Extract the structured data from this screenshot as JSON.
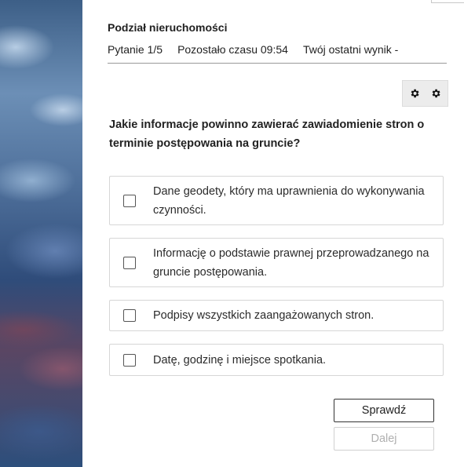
{
  "quiz": {
    "title": "Podział nieruchomości",
    "question_counter": "Pytanie 1/5",
    "time_left": "Pozostało czasu 09:54",
    "last_score": "Twój ostatni wynik -"
  },
  "toolbar": {
    "icons": [
      "gear-icon",
      "gear-icon"
    ]
  },
  "question": {
    "text": "Jakie informacje powinno zawierać zawiadomienie stron o terminie postępowania na gruncie?"
  },
  "options": [
    {
      "label": "Dane geodety, który ma uprawnienia do wykonywania czynności.",
      "checked": false
    },
    {
      "label": "Informację o podstawie prawnej przeprowadzanego na gruncie postępowania.",
      "checked": false
    },
    {
      "label": "Podpisy wszystkich zaangażowanych stron.",
      "checked": false
    },
    {
      "label": "Datę, godzinę i miejsce spotkania.",
      "checked": false
    }
  ],
  "buttons": {
    "check": "Sprawdź",
    "next": "Dalej"
  },
  "colors": {
    "text": "#222222",
    "border": "#d6d6d6",
    "disabled_text": "#b0b0b0"
  }
}
